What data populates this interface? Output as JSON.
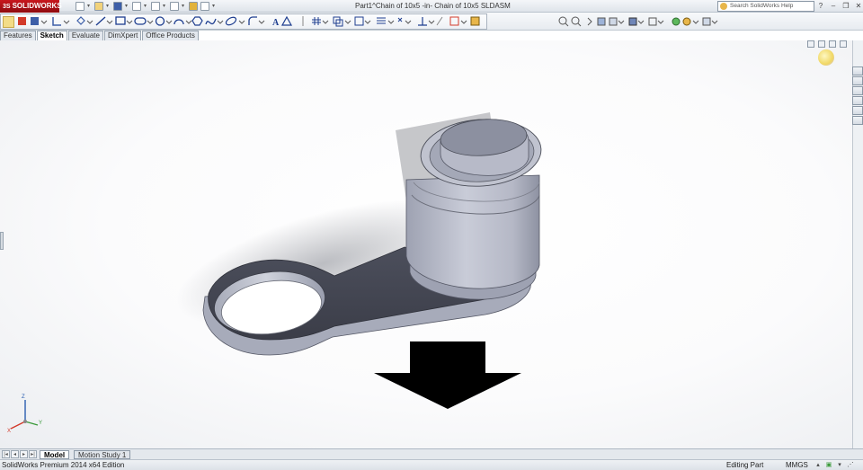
{
  "app": {
    "brand": "SOLIDWORKS",
    "document_title": "Part1^Chain of 10x5 -in- Chain of 10x5 SLDASM",
    "search_placeholder": "Search SolidWorks Help"
  },
  "command_manager": {
    "tabs": [
      {
        "label": "Features",
        "active": false
      },
      {
        "label": "Sketch",
        "active": true
      },
      {
        "label": "Evaluate",
        "active": false
      },
      {
        "label": "DimXpert",
        "active": false
      },
      {
        "label": "Office Products",
        "active": false
      }
    ]
  },
  "bottom_tabs": [
    {
      "label": "Model",
      "active": true
    },
    {
      "label": "Motion Study 1",
      "active": false
    }
  ],
  "nav_arrows": [
    "|◂",
    "◂",
    "▸",
    "▸|"
  ],
  "status": {
    "edition": "SolidWorks Premium 2014 x64 Edition",
    "mode": "Editing Part",
    "units": "MMGS"
  },
  "triad": {
    "x": "X",
    "y": "Y",
    "z": "Z"
  },
  "colors": {
    "part_face": "#b8bccb",
    "part_shadow": "#4a4d59",
    "arrow": "#000000",
    "accent": "#c8161d"
  },
  "icons": {
    "select": "select-icon",
    "line": "line-icon",
    "rectangle": "rectangle-icon",
    "circle": "circle-icon",
    "arc": "arc-icon",
    "spline": "spline-icon",
    "zoom": "zoom-icon"
  }
}
